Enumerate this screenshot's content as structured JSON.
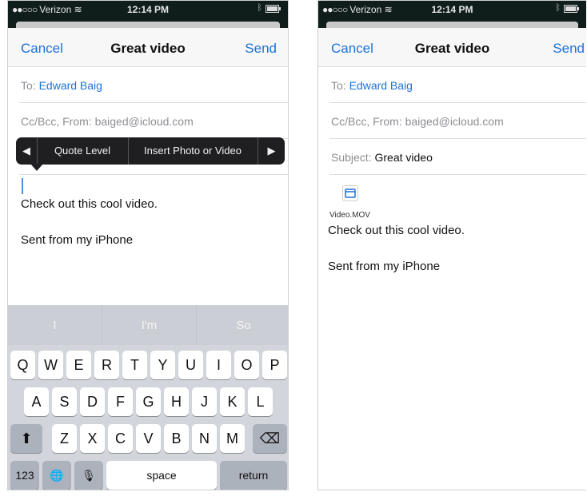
{
  "left": {
    "status": {
      "carrier": "Verizon",
      "time": "12:14 PM"
    },
    "nav": {
      "cancel": "Cancel",
      "title": "Great video",
      "send": "Send"
    },
    "to": {
      "label": "To:",
      "value": "Edward Baig"
    },
    "ccbcc": {
      "label": "Cc/Bcc, From:",
      "value": "baiged@icloud.com"
    },
    "popover": {
      "item1": "Quote Level",
      "item2": "Insert Photo or Video"
    },
    "body": {
      "line1": "Check out this cool video.",
      "line2": "Sent from my iPhone"
    },
    "suggestions": [
      "I",
      "I'm",
      "So"
    ],
    "keyboard": {
      "row1": [
        "Q",
        "W",
        "E",
        "R",
        "T",
        "Y",
        "U",
        "I",
        "O",
        "P"
      ],
      "row2": [
        "A",
        "S",
        "D",
        "F",
        "G",
        "H",
        "J",
        "K",
        "L"
      ],
      "row3": [
        "Z",
        "X",
        "C",
        "V",
        "B",
        "N",
        "M"
      ],
      "numbers": "123",
      "space": "space",
      "return": "return"
    }
  },
  "right": {
    "status": {
      "carrier": "Verizon",
      "time": "12:14 PM"
    },
    "nav": {
      "cancel": "Cancel",
      "title": "Great video",
      "send": "Send"
    },
    "to": {
      "label": "To:",
      "value": "Edward Baig"
    },
    "ccbcc": {
      "label": "Cc/Bcc, From:",
      "value": "baiged@icloud.com"
    },
    "subject": {
      "label": "Subject:",
      "value": "Great video"
    },
    "attachment": {
      "name": "Video.MOV",
      "icon": "video-file-icon"
    },
    "body": {
      "line1": "Check out this cool video.",
      "line2": "Sent from my iPhone"
    }
  },
  "colors": {
    "accent": "#1a73d9",
    "statusbar": "#0f1e1b",
    "popover": "#1f1f21",
    "keyboard": "#d2d5db"
  }
}
